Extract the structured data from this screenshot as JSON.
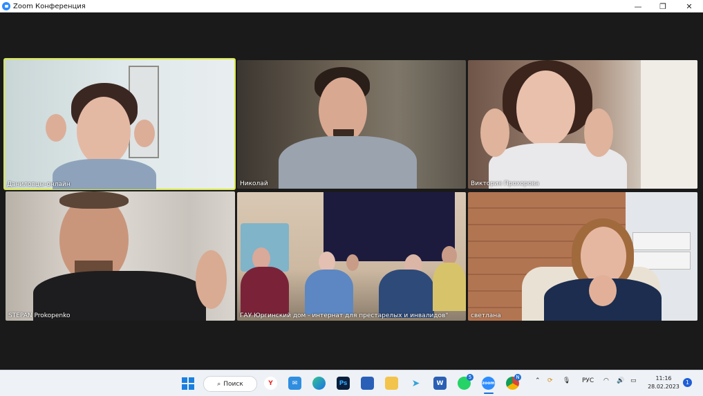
{
  "window": {
    "title": "Zoom Конференция",
    "minimize_glyph": "—",
    "restore_glyph": "❐",
    "close_glyph": "✕"
  },
  "participants": [
    {
      "name": "Даниловцы-онлайн",
      "active": true
    },
    {
      "name": "Николай",
      "active": false
    },
    {
      "name": "Виктория Прохорова",
      "active": false
    },
    {
      "name": "STEPAN Prokopenko",
      "active": false
    },
    {
      "name": "ГАУ Юргинский дом - интернат для престарелых и инвалидов\"",
      "active": false
    },
    {
      "name": "светлана",
      "active": false
    }
  ],
  "taskbar": {
    "search_label": "Поиск",
    "apps": [
      "windows-start-icon",
      "yandex-browser-icon",
      "mail-icon",
      "edge-icon",
      "photoshop-icon",
      "store-icon",
      "file-explorer-icon",
      "telegram-icon",
      "word-icon",
      "whatsapp-icon",
      "zoom-icon",
      "chrome-icon"
    ],
    "ps_label": "Ps",
    "word_label": "W",
    "zoom_label": "zoom",
    "yandex_label": "Y",
    "whatsapp_badge": "5",
    "chrome_badge": "N",
    "language": "РУС",
    "time": "11:16",
    "date": "28.02.2023",
    "notifications": "1"
  }
}
